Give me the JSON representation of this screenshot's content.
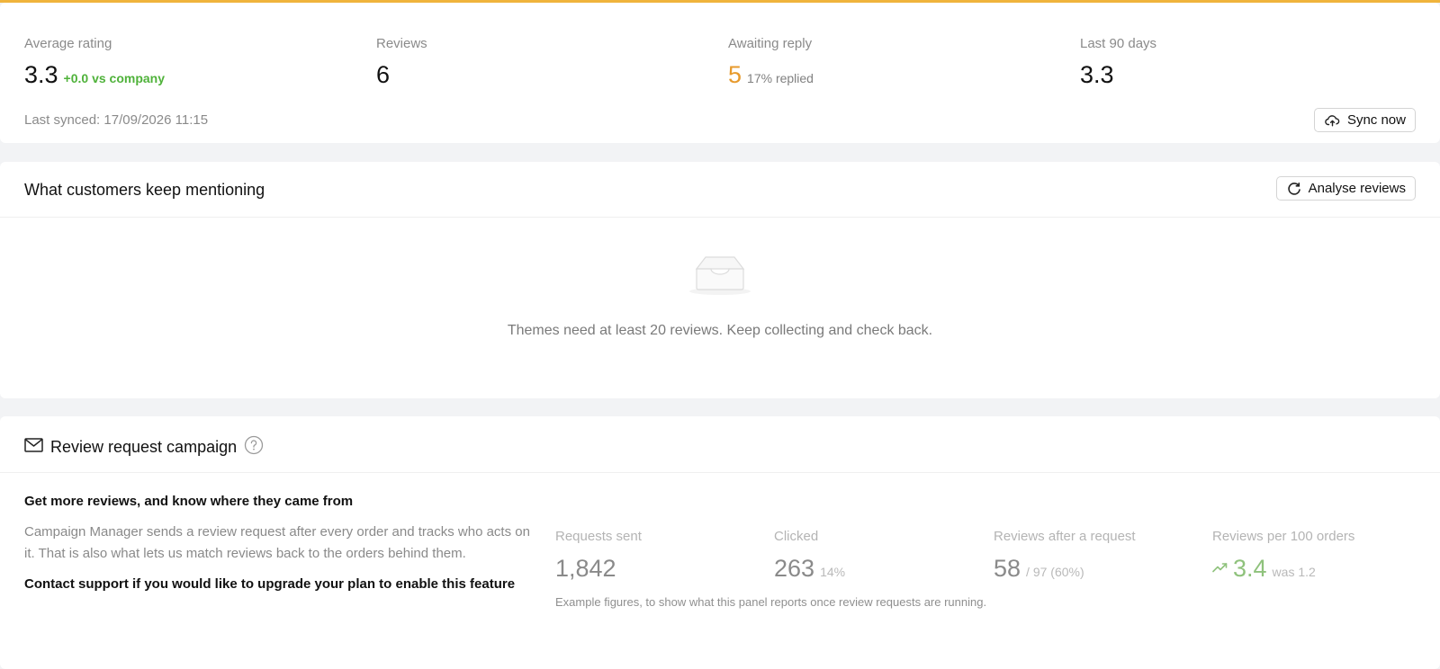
{
  "colors": {
    "accent_top": "#f0b43c",
    "positive": "#4fb23a",
    "warning": "#e79a2c",
    "muted_positive": "#8fc27c"
  },
  "stats": {
    "average_rating": {
      "label": "Average rating",
      "value": "3.3",
      "delta": "+0.0 vs company"
    },
    "reviews": {
      "label": "Reviews",
      "value": "6"
    },
    "awaiting_reply": {
      "label": "Awaiting reply",
      "value": "5",
      "sub": "17% replied"
    },
    "last_90_days": {
      "label": "Last 90 days",
      "value": "3.3"
    },
    "last_synced": "Last synced: 17/09/2026 11:15",
    "sync_button": {
      "label": "Sync now",
      "icon": "cloud-sync-icon"
    }
  },
  "themes": {
    "title": "What customers keep mentioning",
    "analyse_button": {
      "label": "Analyse reviews",
      "icon": "refresh-icon"
    },
    "empty_icon": "inbox-icon",
    "empty_text": "Themes need at least 20 reviews. Keep collecting and check back."
  },
  "campaign": {
    "title": "Review request campaign",
    "title_icon": "mail-icon",
    "help_icon": "help-icon",
    "heading": "Get more reviews, and know where they came from",
    "description": "Campaign Manager sends a review request after every order and tracks who acts on it. That is also what lets us match reviews back to the orders behind them.",
    "cta": "Contact support if you would like to upgrade your plan to enable this feature",
    "metrics": {
      "requests_sent": {
        "label": "Requests sent",
        "value": "1,842"
      },
      "clicked": {
        "label": "Clicked",
        "value": "263",
        "suffix": "14%"
      },
      "reviews_after_request": {
        "label": "Reviews after a request",
        "value": "58",
        "suffix": "/ 97 (60%)"
      },
      "reviews_per_100": {
        "label": "Reviews per 100 orders",
        "value": "3.4",
        "suffix": "was 1.2",
        "trend_icon": "trend-up-icon"
      }
    },
    "example_note": "Example figures, to show what this panel reports once review requests are running."
  }
}
